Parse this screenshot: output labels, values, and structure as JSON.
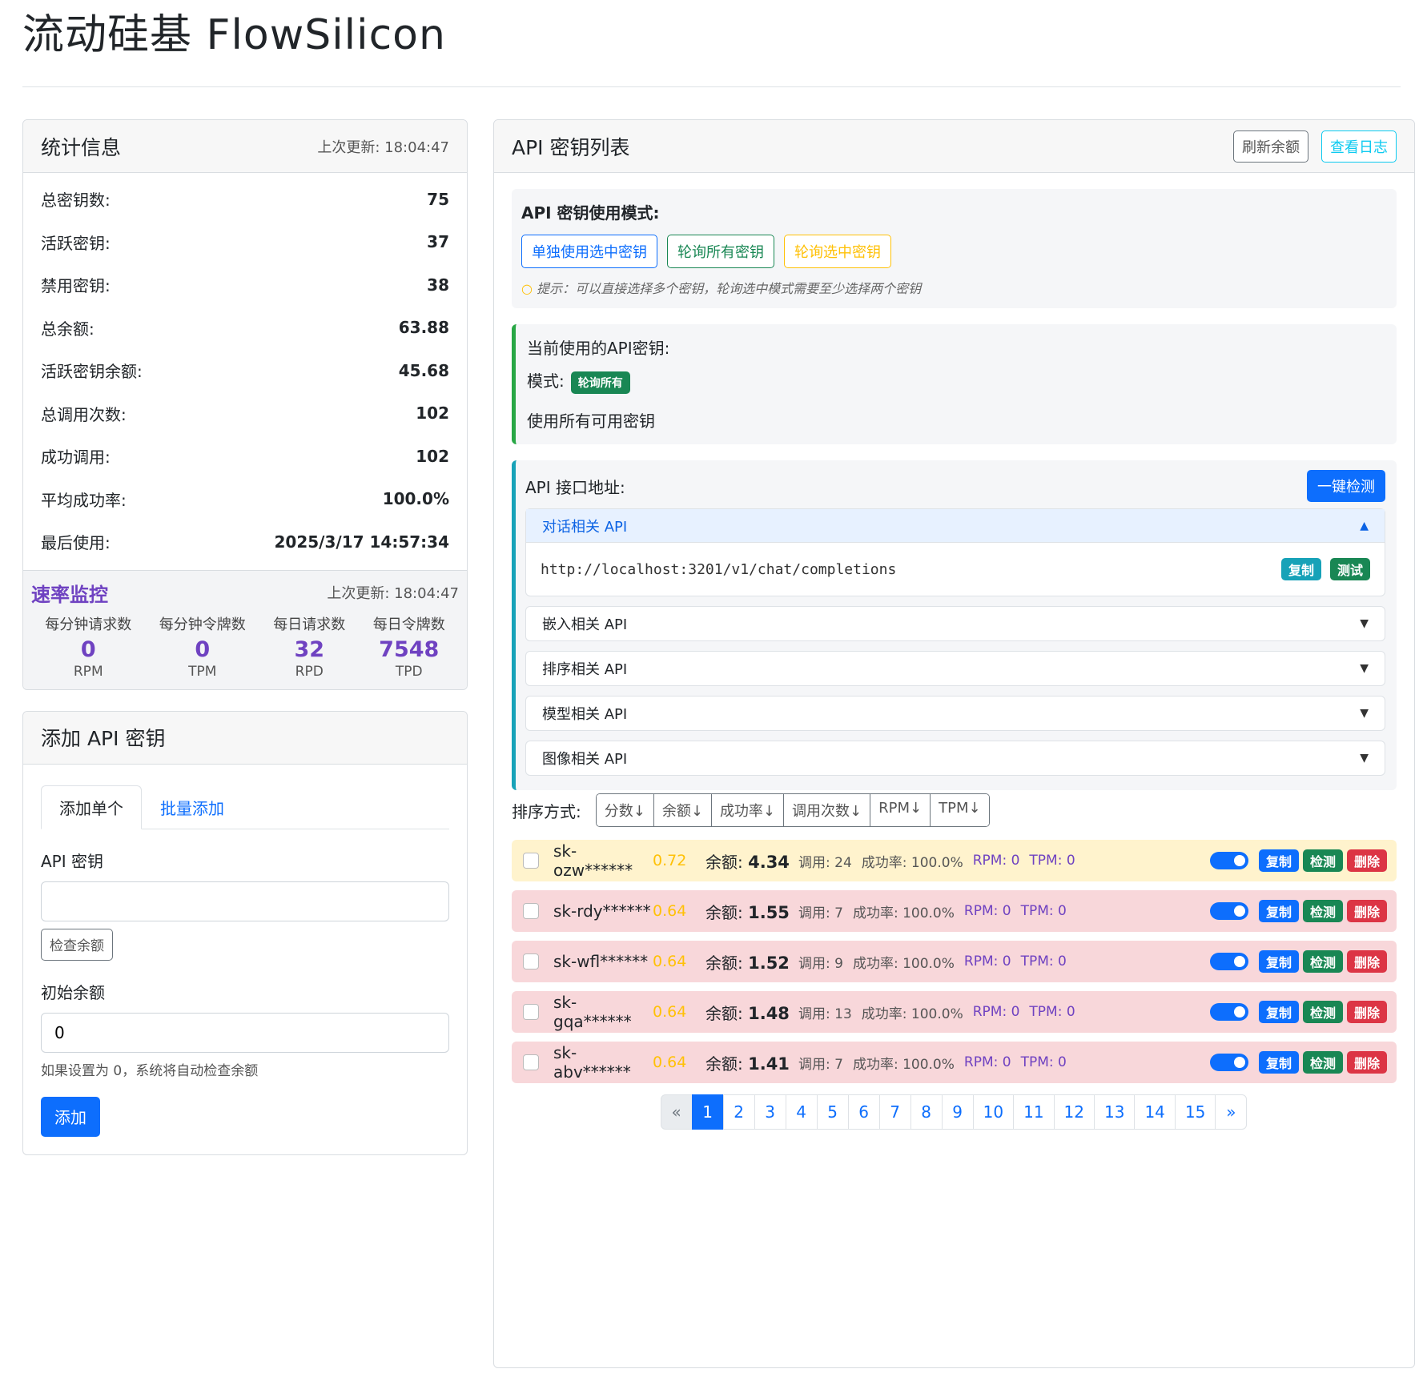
{
  "app": {
    "title": "流动硅基 FlowSilicon"
  },
  "stats": {
    "title": "统计信息",
    "updated": "上次更新: 18:04:47",
    "rows": [
      {
        "label": "总密钥数:",
        "value": "75"
      },
      {
        "label": "活跃密钥:",
        "value": "37"
      },
      {
        "label": "禁用密钥:",
        "value": "38"
      },
      {
        "label": "总余额:",
        "value": "63.88"
      },
      {
        "label": "活跃密钥余额:",
        "value": "45.68"
      },
      {
        "label": "总调用次数:",
        "value": "102"
      },
      {
        "label": "成功调用:",
        "value": "102"
      },
      {
        "label": "平均成功率:",
        "value": "100.0%"
      },
      {
        "label": "最后使用:",
        "value": "2025/3/17 14:57:34"
      }
    ]
  },
  "rate": {
    "title": "速率监控",
    "updated": "上次更新: 18:04:47",
    "items": [
      {
        "label": "每分钟请求数",
        "value": "0",
        "unit": "RPM"
      },
      {
        "label": "每分钟令牌数",
        "value": "0",
        "unit": "TPM"
      },
      {
        "label": "每日请求数",
        "value": "32",
        "unit": "RPD"
      },
      {
        "label": "每日令牌数",
        "value": "7548",
        "unit": "TPD"
      }
    ]
  },
  "add": {
    "title": "添加 API 密钥",
    "tab_single": "添加单个",
    "tab_batch": "批量添加",
    "key_label": "API 密钥",
    "key_value": "",
    "check_btn": "检查余额",
    "balance_label": "初始余额",
    "balance_value": "0",
    "help": "如果设置为 0，系统将自动检查余额",
    "submit": "添加"
  },
  "keys_panel": {
    "title": "API 密钥列表",
    "refresh_btn": "刷新余额",
    "logs_btn": "查看日志",
    "mode_title": "API 密钥使用模式:",
    "mode_single": "单独使用选中密钥",
    "mode_all": "轮询所有密钥",
    "mode_selected": "轮询选中密钥",
    "hint": "提示：可以直接选择多个密钥，轮询选中模式需要至少选择两个密钥",
    "current_title": "当前使用的API密钥:",
    "mode_label": "模式:",
    "mode_badge": "轮询所有",
    "current_desc": "使用所有可用密钥",
    "api_title": "API 接口地址:",
    "check_all_btn": "一键检测",
    "accordions": [
      {
        "label": "对话相关 API",
        "open": true,
        "url": "http://localhost:3201/v1/chat/completions"
      },
      {
        "label": "嵌入相关 API"
      },
      {
        "label": "排序相关 API"
      },
      {
        "label": "模型相关 API"
      },
      {
        "label": "图像相关 API"
      }
    ],
    "copy_btn": "复制",
    "test_btn": "测试",
    "sort_label": "排序方式:",
    "sort_options": [
      "分数↓",
      "余额↓",
      "成功率↓",
      "调用次数↓",
      "RPM↓",
      "TPM↓"
    ],
    "rows": [
      {
        "key": "sk-ozw******",
        "score": "0.72",
        "balance_label": "余额:",
        "balance": "4.34",
        "calls": "调用: 24",
        "success": "成功率: 100.0%",
        "rpm": "RPM: 0",
        "tpm": "TPM: 0",
        "status": "warning"
      },
      {
        "key": "sk-rdy******",
        "score": "0.64",
        "balance_label": "余额:",
        "balance": "1.55",
        "calls": "调用: 7",
        "success": "成功率: 100.0%",
        "rpm": "RPM: 0",
        "tpm": "TPM: 0",
        "status": "danger"
      },
      {
        "key": "sk-wfl******",
        "score": "0.64",
        "balance_label": "余额:",
        "balance": "1.52",
        "calls": "调用: 9",
        "success": "成功率: 100.0%",
        "rpm": "RPM: 0",
        "tpm": "TPM: 0",
        "status": "danger"
      },
      {
        "key": "sk-gqa******",
        "score": "0.64",
        "balance_label": "余额:",
        "balance": "1.48",
        "calls": "调用: 13",
        "success": "成功率: 100.0%",
        "rpm": "RPM: 0",
        "tpm": "TPM: 0",
        "status": "danger"
      },
      {
        "key": "sk-abv******",
        "score": "0.64",
        "balance_label": "余额:",
        "balance": "1.41",
        "calls": "调用: 7",
        "success": "成功率: 100.0%",
        "rpm": "RPM: 0",
        "tpm": "TPM: 0",
        "status": "danger"
      }
    ],
    "row_copy": "复制",
    "row_check": "检测",
    "row_delete": "删除",
    "pagination": {
      "prev": "«",
      "next": "»",
      "pages": [
        "1",
        "2",
        "3",
        "4",
        "5",
        "6",
        "7",
        "8",
        "9",
        "10",
        "11",
        "12",
        "13",
        "14",
        "15"
      ],
      "current": "1"
    }
  },
  "colors": {
    "primary": "#0d6efd",
    "success": "#198754",
    "danger": "#dc3545",
    "info": "#17a2b8",
    "warning": "#ffc107",
    "purple": "#6f42c1"
  }
}
